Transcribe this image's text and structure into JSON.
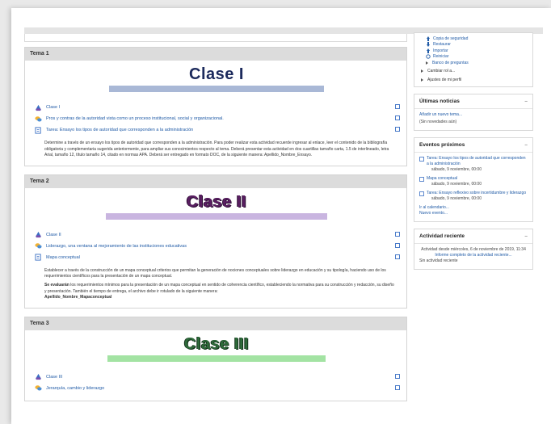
{
  "sections": [
    {
      "header": "Tema 1",
      "banner": "Clase I",
      "bar_color": "#a9b8d6",
      "activities": [
        {
          "label": "Clase I",
          "type": "lesson"
        },
        {
          "label": "Pros y contras de la autoridad vista como un proceso institucional, social y organizacional.",
          "type": "forum"
        },
        {
          "label": "Tarea: Ensayo los tipos de autoridad que corresponden a la administración",
          "type": "assignment"
        }
      ],
      "summary_bold": "",
      "summary": "Determine a través de un ensayo los tipos de autoridad que corresponden a la administración. Para poder realizar esta actividad recuerde ingresar al enlace, leer el contenido de la bibliografía obligatoria y complementaria sugerida anteriormente, para ampliar sus conocimientos respecto al tema. Deberá presentar esta actividad en dos cuartillas tamaño carta, 1.5 de interlineado, letra Arial, tamaño 12, título tamaño 14, citado en normas APA. Deberá ser entregado en formato DOC, de la siguiente manera: Apellido_Nombre_Ensayo.",
      "summary2": ""
    },
    {
      "header": "Tema 2",
      "banner": "Clase II",
      "bar_color": "#c9b5e0",
      "activities": [
        {
          "label": "Clase II",
          "type": "lesson"
        },
        {
          "label": "Liderazgo, una ventana al mejoramiento de las instituciones educativas",
          "type": "forum"
        },
        {
          "label": "Mapa conceptual",
          "type": "assignment"
        }
      ],
      "summary_bold": "",
      "summary": "Establecer a través de la construcción de un mapa conceptual criterios que permitan la generación de nociones conceptuales sobre liderazgo en educación y su tipología, haciendo uso de los requerimientos científicos para la presentación de un mapa conceptual.",
      "summary2_bold": "Se evaluarán",
      "summary2": "los requerimientos mínimos para la presentación de un mapa conceptual en sentido de coherencia científico, estableciendo la normativa para su construcción y redacción, su diseño y presentación. También el tiempo de entrega, el archivo debe ir rotulado de la siguiente manera:",
      "summary3": "Apellido_Nombre_Mapaconceptual"
    },
    {
      "header": "Tema 3",
      "banner": "Clase III",
      "bar_color": "#a3e3a3",
      "activities": [
        {
          "label": "Clase III",
          "type": "lesson"
        },
        {
          "label": "Jerarquía, cambio y liderazgo",
          "type": "forum"
        }
      ]
    }
  ],
  "sidebar": {
    "admin_items": [
      {
        "label": "Copia de seguridad",
        "icon": "backup-icon"
      },
      {
        "label": "Restaurar",
        "icon": "restore-icon"
      },
      {
        "label": "Importar",
        "icon": "import-icon"
      },
      {
        "label": "Reiniciar",
        "icon": "reset-icon"
      },
      {
        "label": "Banco de preguntas",
        "icon": "caret-icon"
      }
    ],
    "admin_top": [
      {
        "label": "Cambiar rol a..."
      },
      {
        "label": "Ajustes de mi perfil"
      }
    ],
    "news": {
      "title": "Últimas noticias",
      "add_link": "Añadir un nuevo tema...",
      "empty": "(Sin novedades aún)"
    },
    "events": {
      "title": "Eventos próximos",
      "items": [
        {
          "title": "Tarea: Ensayo los tipos de autoridad que corresponden a la administración",
          "date": "sábado, 9 noviembre, 00:00"
        },
        {
          "title": "Mapa conceptual",
          "date": "sábado, 9 noviembre, 00:00"
        },
        {
          "title": "Tarea: Ensayo reflexivo sobre incertidumbre y liderazgo",
          "date": "sábado, 9 noviembre, 00:00"
        }
      ],
      "calendar_link": "Ir al calendario...",
      "new_event": "Nuevo evento..."
    },
    "recent": {
      "title": "Actividad reciente",
      "since": "Actividad desde miércoles, 6 de noviembre de 2019, 11:34",
      "report": "Informe completo de la actividad reciente...",
      "none": "Sin actividad reciente"
    }
  }
}
